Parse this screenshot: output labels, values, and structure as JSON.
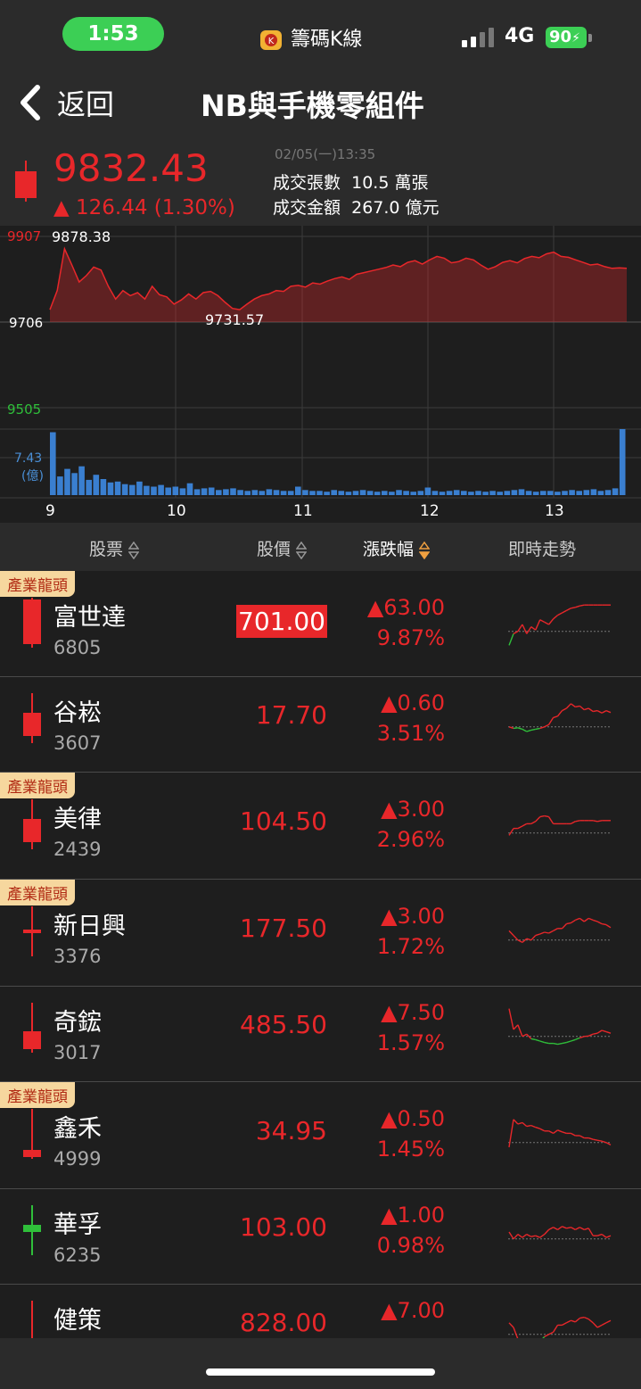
{
  "status_bar": {
    "time": "1:53",
    "app_name": "籌碼K線",
    "network": "4G",
    "battery": "90"
  },
  "nav": {
    "back_label": "返回",
    "title": "NB與手機零組件"
  },
  "quote": {
    "price": "9832.43",
    "change": "▲ 126.44 (1.30%)",
    "datetime": "02/05(一)13:35",
    "volume_label": "成交張數",
    "volume": "10.5 萬張",
    "amount_label": "成交金額",
    "amount": "267.0 億元"
  },
  "chart_data": {
    "type": "area",
    "y_ticks": [
      "9907",
      "9706",
      "9505"
    ],
    "ylim": [
      9505,
      9907
    ],
    "reference": 9706,
    "high_label": "9878.38",
    "low_label": "9731.57",
    "volume_max_label": "7.43",
    "volume_unit_label": "(億)",
    "x_ticks": [
      "9",
      "10",
      "11",
      "12",
      "13"
    ],
    "series": [
      {
        "values": [
          9735,
          9780,
          9878,
          9840,
          9800,
          9815,
          9835,
          9828,
          9790,
          9760,
          9780,
          9768,
          9775,
          9760,
          9790,
          9770,
          9765,
          9748,
          9758,
          9772,
          9760,
          9775,
          9778,
          9768,
          9752,
          9738,
          9735,
          9748,
          9760,
          9768,
          9772,
          9780,
          9778,
          9790,
          9792,
          9788,
          9798,
          9795,
          9802,
          9808,
          9812,
          9806,
          9818,
          9822,
          9826,
          9830,
          9834,
          9840,
          9836,
          9846,
          9850,
          9842,
          9852,
          9860,
          9856,
          9845,
          9848,
          9856,
          9852,
          9840,
          9830,
          9836,
          9846,
          9850,
          9845,
          9855,
          9860,
          9857,
          9866,
          9870,
          9860,
          9858,
          9852,
          9846,
          9840,
          9842,
          9836,
          9832,
          9833,
          9832
        ]
      }
    ],
    "volume": [
      7.43,
      2.2,
      3.1,
      2.6,
      3.4,
      1.8,
      2.4,
      1.9,
      1.5,
      1.6,
      1.3,
      1.2,
      1.6,
      1.1,
      1.0,
      1.2,
      0.9,
      1.0,
      0.8,
      1.4,
      0.7,
      0.8,
      0.9,
      0.6,
      0.7,
      0.8,
      0.6,
      0.5,
      0.6,
      0.5,
      0.7,
      0.6,
      0.5,
      0.5,
      1.0,
      0.6,
      0.5,
      0.5,
      0.4,
      0.6,
      0.5,
      0.4,
      0.5,
      0.6,
      0.5,
      0.4,
      0.5,
      0.4,
      0.6,
      0.5,
      0.4,
      0.5,
      0.9,
      0.5,
      0.4,
      0.5,
      0.6,
      0.5,
      0.4,
      0.5,
      0.4,
      0.5,
      0.4,
      0.5,
      0.6,
      0.7,
      0.5,
      0.4,
      0.5,
      0.5,
      0.4,
      0.5,
      0.6,
      0.5,
      0.6,
      0.7,
      0.5,
      0.6,
      0.8,
      7.8
    ]
  },
  "list_header": {
    "stock": "股票",
    "price": "股價",
    "change": "漲跌幅",
    "trend": "即時走勢"
  },
  "colors": {
    "up": "#e8272a",
    "down": "#2fbf3a",
    "tag_bg": "#f6d79e"
  },
  "stocks": [
    {
      "tag": "產業龍頭",
      "name": "富世達",
      "code": "6805",
      "price": "701.00",
      "change": "▲63.00",
      "pct": "9.87%",
      "limit_up": true,
      "candle": "up-limit",
      "trend": [
        0.05,
        0.3,
        0.35,
        0.5,
        0.3,
        0.45,
        0.38,
        0.6,
        0.55,
        0.5,
        0.62,
        0.7,
        0.75,
        0.8,
        0.85,
        0.87,
        0.9,
        0.92,
        0.92,
        0.92,
        0.92,
        0.92,
        0.92,
        0.92
      ]
    },
    {
      "tag": "",
      "name": "谷崧",
      "code": "3607",
      "price": "17.70",
      "change": "▲0.60",
      "pct": "3.51%",
      "limit_up": false,
      "candle": "up",
      "trend": [
        0.35,
        0.32,
        0.33,
        0.3,
        0.25,
        0.28,
        0.3,
        0.32,
        0.35,
        0.4,
        0.55,
        0.58,
        0.7,
        0.75,
        0.85,
        0.78,
        0.8,
        0.72,
        0.75,
        0.68,
        0.7,
        0.65,
        0.7,
        0.66
      ]
    },
    {
      "tag": "產業龍頭",
      "name": "美律",
      "code": "2439",
      "price": "104.50",
      "change": "▲3.00",
      "pct": "2.96%",
      "limit_up": false,
      "candle": "up",
      "trend": [
        0.3,
        0.45,
        0.45,
        0.5,
        0.55,
        0.55,
        0.6,
        0.7,
        0.72,
        0.7,
        0.55,
        0.55,
        0.55,
        0.55,
        0.55,
        0.6,
        0.62,
        0.62,
        0.62,
        0.62,
        0.6,
        0.62,
        0.62,
        0.62
      ]
    },
    {
      "tag": "產業龍頭",
      "name": "新日興",
      "code": "3376",
      "price": "177.50",
      "change": "▲3.00",
      "pct": "1.72%",
      "limit_up": false,
      "candle": "doji",
      "trend": [
        0.55,
        0.45,
        0.35,
        0.3,
        0.38,
        0.35,
        0.45,
        0.48,
        0.52,
        0.5,
        0.55,
        0.6,
        0.6,
        0.7,
        0.72,
        0.78,
        0.82,
        0.75,
        0.82,
        0.78,
        0.75,
        0.7,
        0.68,
        0.62
      ]
    },
    {
      "tag": "",
      "name": "奇鋐",
      "code": "3017",
      "price": "485.50",
      "change": "▲7.50",
      "pct": "1.57%",
      "limit_up": false,
      "candle": "up-long",
      "trend": [
        0.95,
        0.5,
        0.6,
        0.35,
        0.4,
        0.3,
        0.28,
        0.25,
        0.22,
        0.2,
        0.2,
        0.18,
        0.2,
        0.22,
        0.25,
        0.28,
        0.32,
        0.35,
        0.36,
        0.4,
        0.42,
        0.48,
        0.45,
        0.42
      ]
    },
    {
      "tag": "產業龍頭",
      "name": "鑫禾",
      "code": "4999",
      "price": "34.95",
      "change": "▲0.50",
      "pct": "1.45%",
      "limit_up": false,
      "candle": "up-small",
      "trend": [
        0.25,
        0.85,
        0.75,
        0.78,
        0.7,
        0.72,
        0.68,
        0.65,
        0.6,
        0.6,
        0.55,
        0.62,
        0.58,
        0.55,
        0.55,
        0.5,
        0.5,
        0.45,
        0.45,
        0.42,
        0.4,
        0.38,
        0.35,
        0.3
      ]
    },
    {
      "tag": "",
      "name": "華孚",
      "code": "6235",
      "price": "103.00",
      "change": "▲1.00",
      "pct": "0.98%",
      "limit_up": false,
      "candle": "down",
      "trend": [
        0.5,
        0.35,
        0.45,
        0.38,
        0.45,
        0.4,
        0.42,
        0.38,
        0.45,
        0.55,
        0.6,
        0.55,
        0.62,
        0.58,
        0.6,
        0.55,
        0.6,
        0.55,
        0.58,
        0.42,
        0.42,
        0.45,
        0.38,
        0.42
      ]
    },
    {
      "tag": "",
      "name": "健策",
      "code": "",
      "price": "828.00",
      "change": "▲7.00",
      "pct": "",
      "limit_up": false,
      "candle": "up-small",
      "trend": [
        0.6,
        0.5,
        0.25,
        0.2,
        0.1,
        0.05,
        0.1,
        0.2,
        0.3,
        0.35,
        0.4,
        0.55,
        0.55,
        0.6,
        0.65,
        0.62,
        0.7,
        0.72,
        0.68,
        0.6,
        0.5,
        0.55,
        0.6,
        0.65
      ]
    }
  ]
}
